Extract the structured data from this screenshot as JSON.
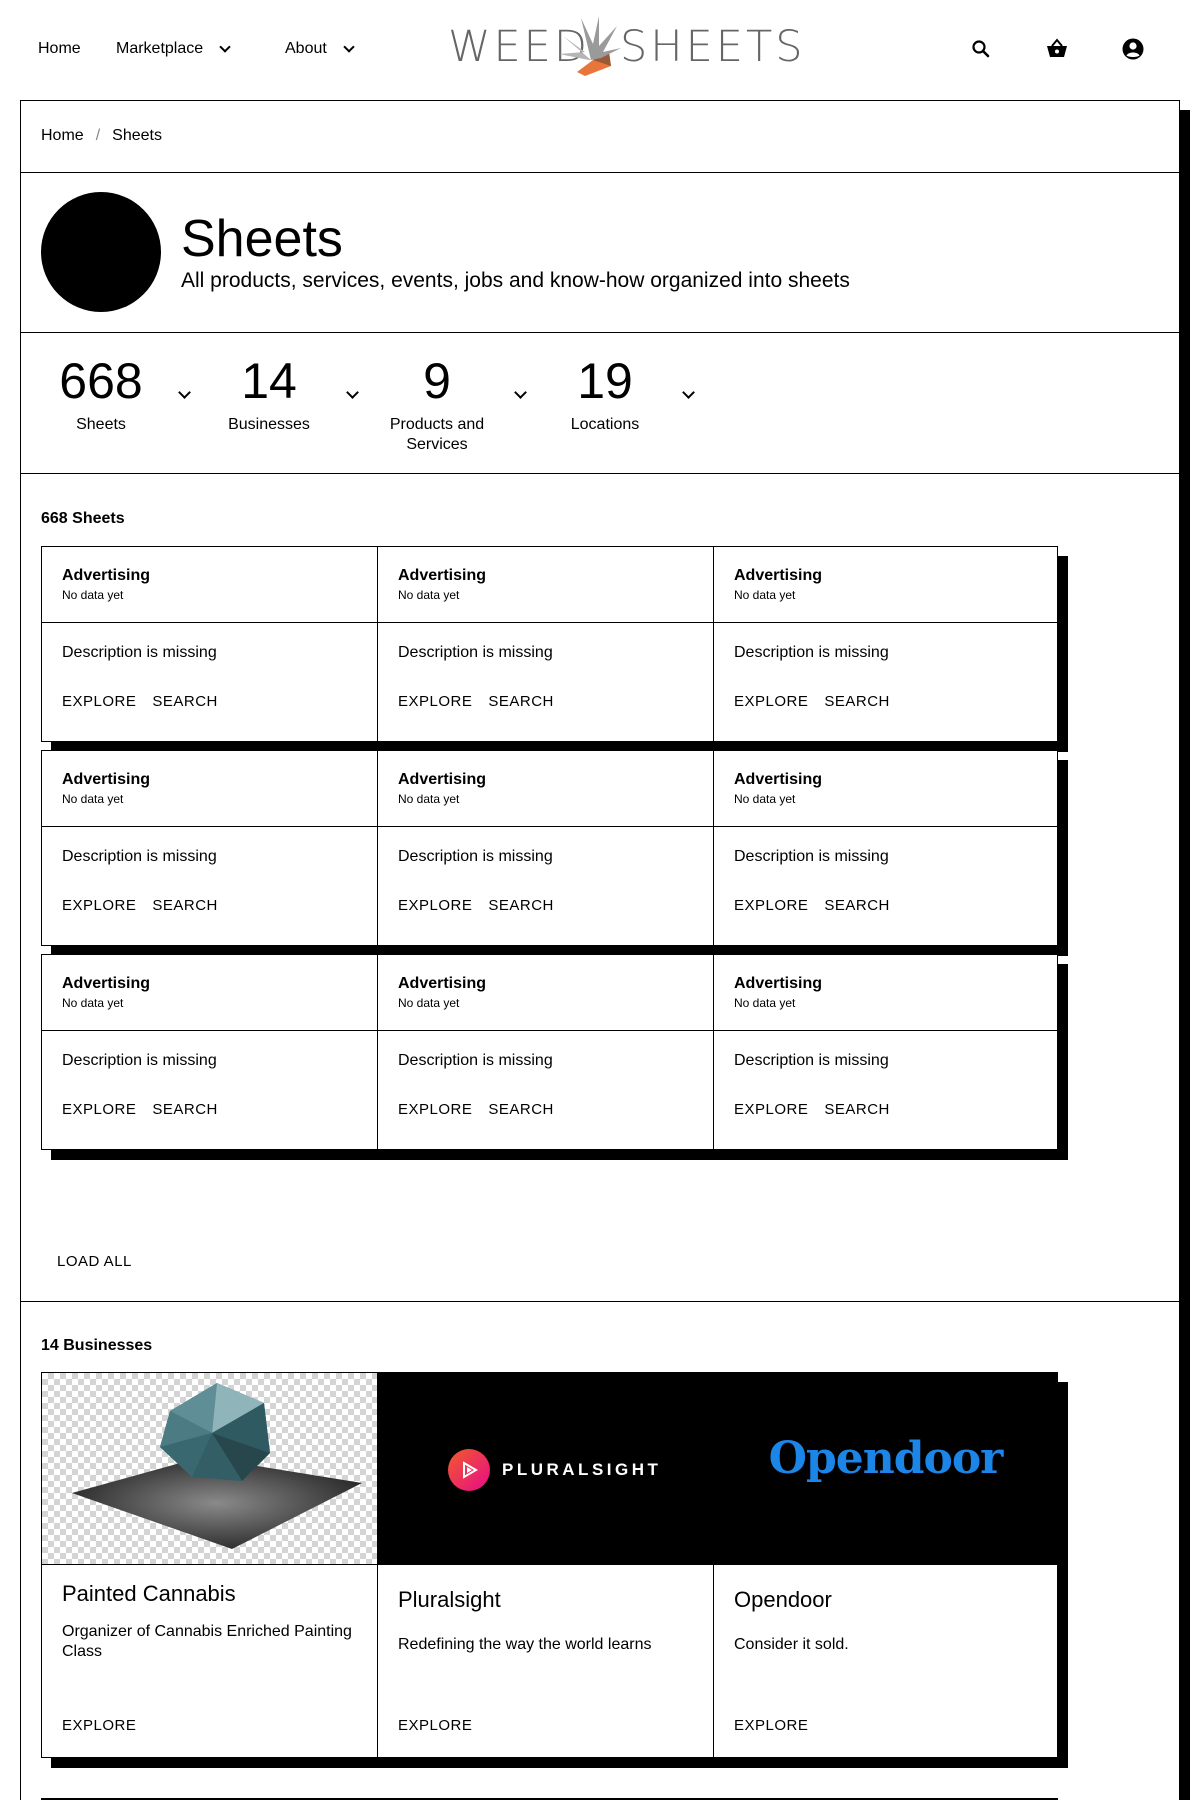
{
  "header": {
    "nav": {
      "home": "Home",
      "marketplace": "Marketplace",
      "about": "About"
    },
    "logo": {
      "left_text": "WEED",
      "right_text": "SHEETS"
    },
    "icons": [
      "search-icon",
      "basket-icon",
      "account-icon"
    ]
  },
  "breadcrumb": {
    "home": "Home",
    "separator": "/",
    "current": "Sheets"
  },
  "page": {
    "title": "Sheets",
    "subtitle": "All products, services, events, jobs and know-how organized into sheets"
  },
  "stats": [
    {
      "value": "668",
      "label": "Sheets"
    },
    {
      "value": "14",
      "label": "Businesses"
    },
    {
      "value": "9",
      "label": "Products and Services"
    },
    {
      "value": "19",
      "label": "Locations"
    }
  ],
  "sheets_section": {
    "title": "668 Sheets",
    "cards": [
      {
        "title": "Advertising",
        "subtitle": "No data yet",
        "description": "Description is missing",
        "explore": "EXPLORE",
        "search": "SEARCH"
      },
      {
        "title": "Advertising",
        "subtitle": "No data yet",
        "description": "Description is missing",
        "explore": "EXPLORE",
        "search": "SEARCH"
      },
      {
        "title": "Advertising",
        "subtitle": "No data yet",
        "description": "Description is missing",
        "explore": "EXPLORE",
        "search": "SEARCH"
      },
      {
        "title": "Advertising",
        "subtitle": "No data yet",
        "description": "Description is missing",
        "explore": "EXPLORE",
        "search": "SEARCH"
      },
      {
        "title": "Advertising",
        "subtitle": "No data yet",
        "description": "Description is missing",
        "explore": "EXPLORE",
        "search": "SEARCH"
      },
      {
        "title": "Advertising",
        "subtitle": "No data yet",
        "description": "Description is missing",
        "explore": "EXPLORE",
        "search": "SEARCH"
      },
      {
        "title": "Advertising",
        "subtitle": "No data yet",
        "description": "Description is missing",
        "explore": "EXPLORE",
        "search": "SEARCH"
      },
      {
        "title": "Advertising",
        "subtitle": "No data yet",
        "description": "Description is missing",
        "explore": "EXPLORE",
        "search": "SEARCH"
      },
      {
        "title": "Advertising",
        "subtitle": "No data yet",
        "description": "Description is missing",
        "explore": "EXPLORE",
        "search": "SEARCH"
      }
    ],
    "load_all": "LOAD ALL"
  },
  "businesses_section": {
    "title": "14 Businesses",
    "cards": [
      {
        "name": "Painted Cannabis",
        "description": "Organizer of Cannabis Enriched Painting Class",
        "explore": "EXPLORE",
        "image": "crystal-render"
      },
      {
        "name": "Pluralsight",
        "description": "Redefining the way the world learns",
        "explore": "EXPLORE",
        "image": "pluralsight-logo",
        "logo_text": "PLURALSIGHT"
      },
      {
        "name": "Opendoor",
        "description": "Consider it sold.",
        "explore": "EXPLORE",
        "image": "opendoor-logo",
        "logo_text": "Opendoor"
      }
    ]
  },
  "colors": {
    "accent_pluralsight": "#e80a89",
    "accent_opendoor": "#1c85e8",
    "logo_gray": "#666666",
    "logo_orange": "#e8763a"
  }
}
